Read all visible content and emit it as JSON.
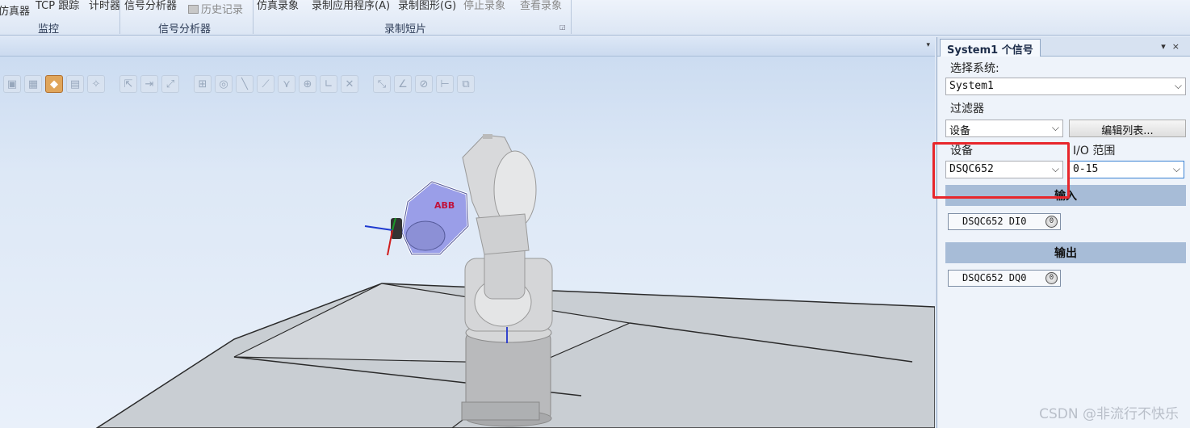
{
  "ribbon": {
    "items": {
      "sim_clip": "仿真器",
      "tcp_trace": "TCP 跟踪",
      "timer": "计时器",
      "signal_analyzer_btn": "信号分析器",
      "history": "历史记录",
      "sim_record": "仿真录象",
      "record_app": "录制应用程序(A)",
      "record_graphics": "录制图形(G)",
      "stop_record": "停止录象",
      "view_record": "查看录象"
    },
    "groups": {
      "monitor": "监控",
      "signal_analyzer": "信号分析器",
      "record_clip": "录制短片"
    }
  },
  "viewport": {
    "toolbar_icons": [
      "select-part-icon",
      "select-group-icon",
      "select-mechanism-icon",
      "select-body-icon",
      "select-target-icon",
      "snap-object-icon",
      "snap-center-icon",
      "snap-edge-icon",
      "snap-grid-icon",
      "snap-mid-icon",
      "snap-end-icon",
      "snap-circle-icon",
      "snap-local-icon",
      "snap-point-icon",
      "measure-distance-icon",
      "measure-angle-icon",
      "measure-diameter-icon",
      "measure-minimum-icon",
      "measure-icon"
    ]
  },
  "panel": {
    "tab_title": "System1 个信号",
    "select_system_label": "选择系统:",
    "system_value": "System1",
    "filter_label": "过滤器",
    "filter_value": "设备",
    "edit_list_button": "编辑列表...",
    "device_label": "设备",
    "io_range_label": "I/O 范围",
    "device_value": "DSQC652",
    "io_range_value": "0-15",
    "input_header": "输入",
    "input_signals": [
      "DSQC652 DI0"
    ],
    "output_header": "输出",
    "output_signals": [
      "DSQC652 DQ0"
    ],
    "led_value": "0"
  },
  "watermark": "CSDN @非流行不快乐",
  "colors": {
    "highlight_box": "#e8262b",
    "section_header": "#a7bcd7",
    "robot_tool": "#9a9ee8"
  }
}
